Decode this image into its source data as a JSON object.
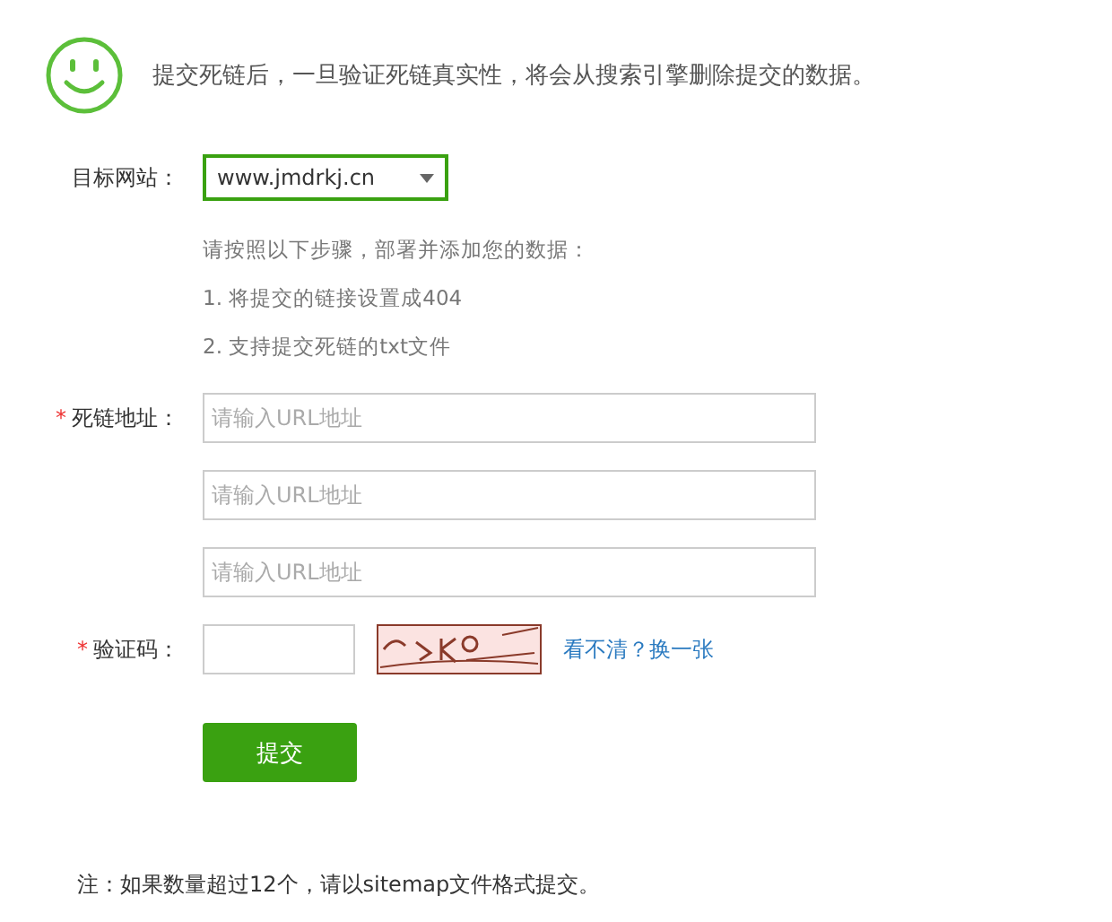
{
  "header": {
    "message": "提交死链后，一旦验证死链真实性，将会从搜索引擎删除提交的数据。"
  },
  "site": {
    "label": "目标网站：",
    "value": "www.jmdrkj.cn"
  },
  "instructions": [
    "请按照以下步骤，部署并添加您的数据：",
    "1. 将提交的链接设置成404",
    "2. 支持提交死链的txt文件"
  ],
  "dead_links": {
    "required_mark": "*",
    "label": "死链地址：",
    "fields": [
      {
        "placeholder": "请输入URL地址"
      },
      {
        "placeholder": "请输入URL地址"
      },
      {
        "placeholder": "请输入URL地址"
      }
    ]
  },
  "captcha": {
    "required_mark": "*",
    "label": "验证码：",
    "refresh_link": "看不清？换一张"
  },
  "submit_button": "提交",
  "note": "注：如果数量超过12个，请以sitemap文件格式提交。"
}
